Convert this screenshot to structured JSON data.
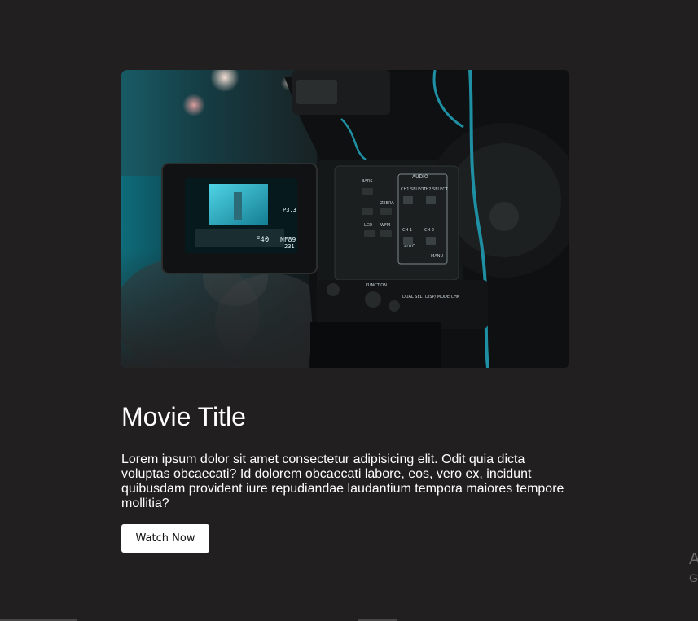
{
  "movie": {
    "title": "Movie Title",
    "description": "Lorem ipsum dolor sit amet consectetur adipisicing elit. Odit quia dicta voluptas obcaecati? Id dolorem obcaecati labore, eos, vero ex, incidunt quibusdam provident iure repudiandae laudantium tempora maiores tempore mollitia?",
    "watch_label": "Watch Now",
    "image_icon": "camera-icon"
  },
  "camera_screen": {
    "f_value": "F40",
    "nf_value": "NF89",
    "p_value": "P3.3",
    "count_value": "231"
  },
  "camera_panel": {
    "audio_label": "AUDIO",
    "ch1_select": "CH1 SELECT",
    "ch2_select": "CH2 SELECT",
    "ch1": "CH 1",
    "ch2": "CH 2",
    "zebra": "ZEBRA",
    "bars": "BARS",
    "lcd": "LCD",
    "wfm": "WFM",
    "function": "FUNCTION",
    "dual_sel": "DUAL SEL",
    "disp_mode": "DISP/ MODE CHK",
    "auto": "AUTO",
    "manu": "MANU"
  },
  "side": {
    "letter_a": "A",
    "letter_g": "G"
  },
  "colors": {
    "background": "#221f20",
    "button_bg": "#ffffff",
    "text": "#ffffff",
    "teal_accent": "#1f8fa3"
  }
}
